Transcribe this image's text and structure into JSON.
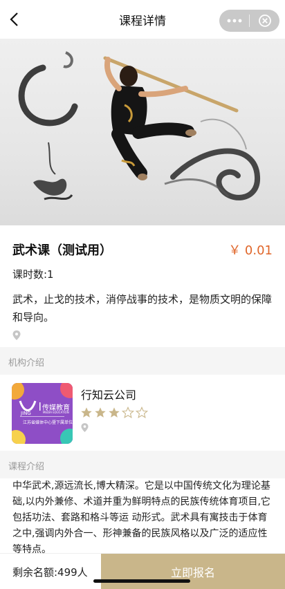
{
  "nav": {
    "title": "课程详情",
    "back_icon": "chevron-left-icon",
    "more_icon": "more-dots-icon",
    "close_icon": "circle-close-icon"
  },
  "hero": {
    "image": "martial-arts-performer-ink-painting"
  },
  "course": {
    "title": "武术课（测试用）",
    "price": "￥ 0.01",
    "lesson_count": "课时数:1",
    "description": "武术，止戈的技术，消停战事的技术，是物质文明的保障和导向。",
    "location_icon": "location-pin-icon"
  },
  "org_section": {
    "header": "机构介绍",
    "name": "行知云公司",
    "rating": 3,
    "rating_max": 5,
    "logo_text": {
      "brand": "JING",
      "brand_cn": "传媒教育",
      "brand_en": "MEDIA EDUCATION",
      "tagline": "江苏省媒体中心暨下属单位"
    }
  },
  "intro_section": {
    "header": "课程介绍",
    "text": "中华武术,源远流长,博大精深。它是以中国传统文化为理论基础,以内外兼修、术道并重为鲜明特点的民族传统体育项目,它包括功法、套路和格斗等运 动形式。武术具有寓技击于体育之中,强调内外合一、形神兼备的民族风格以及广泛的适应性等特点。"
  },
  "bottom": {
    "remaining": "剩余名额:499人",
    "signup_label": "立即报名"
  },
  "colors": {
    "price": "#e0662a",
    "signup_bg": "#c9b68a",
    "star_filled": "#c9b68a",
    "section_bg": "#f5f5f5"
  }
}
